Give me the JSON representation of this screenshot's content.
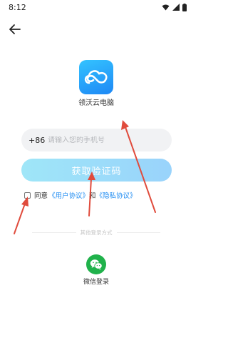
{
  "status_bar": {
    "time": "8:12"
  },
  "app": {
    "name": "领沃云电脑"
  },
  "login": {
    "country_code": "+86",
    "phone_placeholder": "请输入您的手机号",
    "get_code_label": "获取验证码",
    "agree_prefix": "同意",
    "user_agreement": "《用户协议》",
    "and": "和",
    "privacy_policy": "《隐私协议》",
    "other_methods": "其他登录方式",
    "wechat_label": "微信登录"
  },
  "colors": {
    "accent": "#1f8cf2",
    "button": "#9fe6f8",
    "wechat": "#20b24b",
    "annotation": "#e04b3c"
  },
  "icons": {
    "back": "arrow-left-icon",
    "logo": "cloud-logo-icon",
    "wechat": "wechat-icon"
  }
}
